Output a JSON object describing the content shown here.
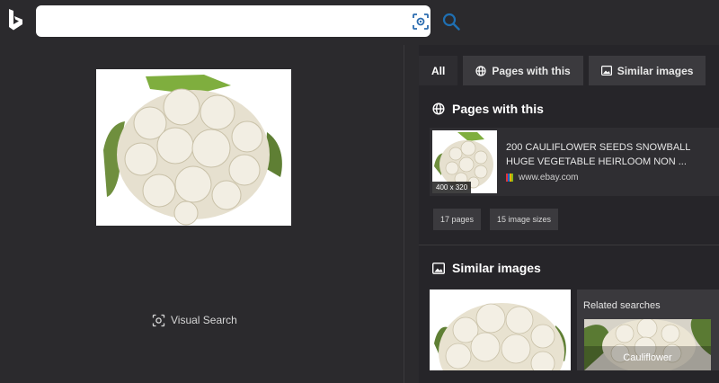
{
  "search": {
    "value": "",
    "placeholder": ""
  },
  "icons": {
    "logo": "bing-logo-icon",
    "visual_search": "visual-search-icon",
    "search": "search-icon",
    "globe": "globe-icon",
    "image": "image-icon"
  },
  "colors": {
    "background": "#2b2a2d",
    "panel": "#262529",
    "accent": "#0f6cbd"
  },
  "left": {
    "visual_search_label": "Visual Search"
  },
  "tabs": [
    {
      "label": "All",
      "active": true
    },
    {
      "label": "Pages with this"
    },
    {
      "label": "Similar images"
    }
  ],
  "pages_section": {
    "title": "Pages with this",
    "result": {
      "title": "200 CAULIFLOWER SEEDS SNOWBALL HUGE VEGETABLE HEIRLOOM NON ...",
      "source": "www.ebay.com",
      "thumb_size": "400 x 320"
    },
    "chips": [
      {
        "label": "17 pages"
      },
      {
        "label": "15 image sizes"
      }
    ]
  },
  "similar_section": {
    "title": "Similar images",
    "related_label": "Related searches",
    "related_item": "Cauliflower"
  }
}
